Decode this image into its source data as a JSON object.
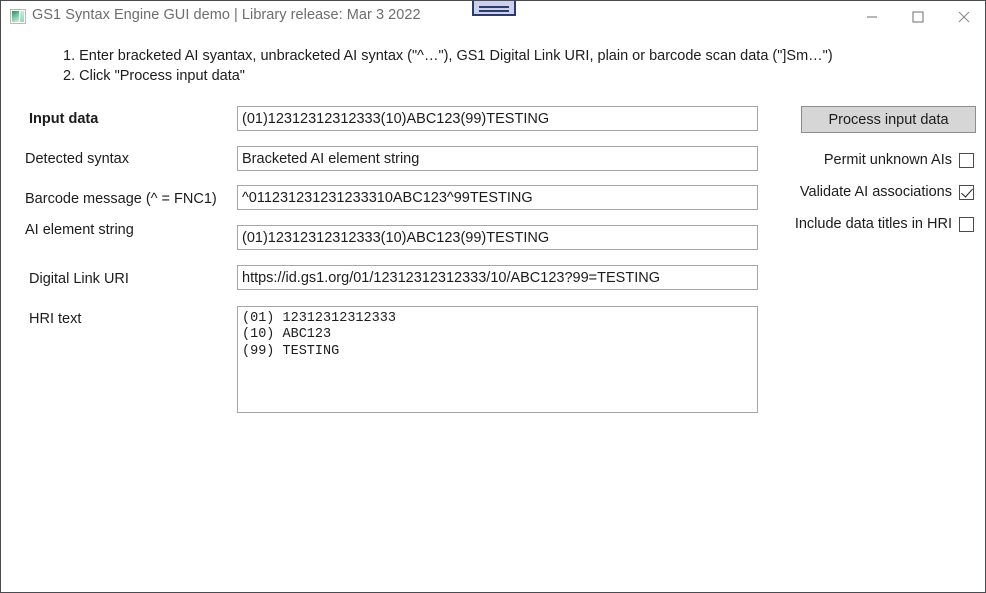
{
  "window": {
    "title": "GS1 Syntax Engine GUI demo | Library release: Mar  3 2022",
    "icon": "image-icon",
    "minimize_label": "Minimize",
    "maximize_label": "Maximize",
    "close_label": "Close"
  },
  "instructions": {
    "line1": "1. Enter bracketed AI syantax, unbracketed AI syntax (\"^…\"), GS1 Digital Link URI, plain or barcode scan data (\"]Sm…\")",
    "line2": "2. Click \"Process input data\""
  },
  "fields": [
    {
      "label": "Input data",
      "value": "(01)12312312312333(10)ABC123(99)TESTING",
      "placeholder": ""
    },
    {
      "label": "Detected syntax",
      "value": "Bracketed AI element string",
      "placeholder": ""
    },
    {
      "label": "Barcode message (^  = FNC1)",
      "value": "^011231231231233310ABC123^99TESTING",
      "placeholder": ""
    },
    {
      "label": "AI element string",
      "value": "(01)12312312312333(10)ABC123(99)TESTING",
      "placeholder": ""
    },
    {
      "label": "Digital Link URI",
      "value": "https://id.gs1.org/01/12312312312333/10/ABC123?99=TESTING",
      "placeholder": ""
    }
  ],
  "hri": {
    "label": "HRI text",
    "value": "(01) 12312312312333\n(10) ABC123\n(99) TESTING"
  },
  "actions": {
    "process_button": "Process input data"
  },
  "options": [
    {
      "label": "Permit unknown AIs",
      "checked": false
    },
    {
      "label": "Validate AI associations",
      "checked": true
    },
    {
      "label": "Include data titles in HRI",
      "checked": false
    }
  ],
  "colors": {
    "window_border": "#4a4a52",
    "title_text": "#6d6d6d",
    "body_text": "#1c1c1c",
    "field_border": "#a6a6a6",
    "button_face": "#d6d6d6",
    "button_border": "#8d8d8d",
    "widget_fill": "#ccd0ec",
    "widget_border": "#2c3c6b"
  }
}
